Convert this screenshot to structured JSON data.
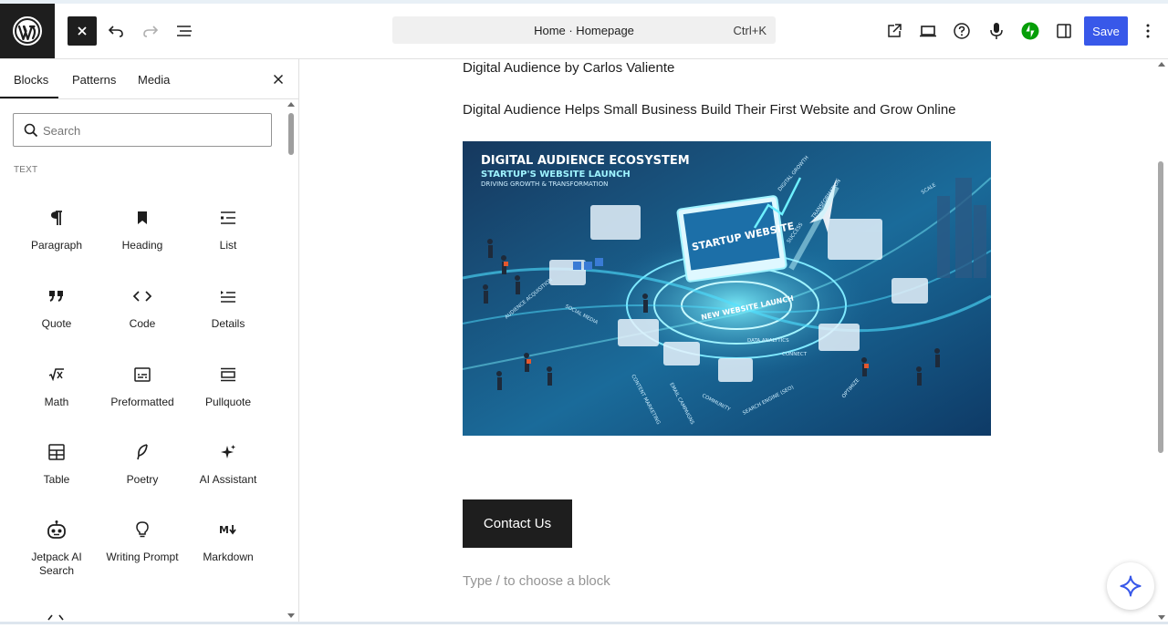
{
  "topbar": {
    "logo_icon": "wordpress-logo",
    "close_inserter_icon": "close-icon",
    "undo_icon": "undo-icon",
    "redo_icon": "redo-icon",
    "document_overview_icon": "list-view-icon",
    "command_bar": {
      "title": "Home · Homepage",
      "shortcut": "Ctrl+K"
    },
    "right_icons": [
      "external-link-icon",
      "desktop-preview-icon",
      "help-icon",
      "microphone-icon",
      "jetpack-icon",
      "sidebar-toggle-icon"
    ],
    "save_label": "Save",
    "options_icon": "more-vertical-icon"
  },
  "sidebar": {
    "tabs": [
      "Blocks",
      "Patterns",
      "Media"
    ],
    "active_tab": "Blocks",
    "search": {
      "placeholder": "Search",
      "value": ""
    },
    "category": "TEXT",
    "blocks": [
      {
        "label": "Paragraph",
        "icon": "paragraph-icon"
      },
      {
        "label": "Heading",
        "icon": "heading-bookmark-icon"
      },
      {
        "label": "List",
        "icon": "list-icon"
      },
      {
        "label": "Quote",
        "icon": "quote-icon"
      },
      {
        "label": "Code",
        "icon": "code-icon"
      },
      {
        "label": "Details",
        "icon": "details-icon"
      },
      {
        "label": "Math",
        "icon": "math-icon"
      },
      {
        "label": "Preformatted",
        "icon": "preformatted-icon"
      },
      {
        "label": "Pullquote",
        "icon": "pullquote-icon"
      },
      {
        "label": "Table",
        "icon": "table-icon"
      },
      {
        "label": "Poetry",
        "icon": "poetry-icon"
      },
      {
        "label": "AI Assistant",
        "icon": "ai-sparkle-icon"
      },
      {
        "label": "Jetpack AI Search",
        "icon": "robot-icon"
      },
      {
        "label": "Writing Prompt",
        "icon": "lightbulb-icon"
      },
      {
        "label": "Markdown",
        "icon": "markdown-icon"
      }
    ]
  },
  "canvas": {
    "line1": "Digital Audience by Carlos Valiente",
    "line2": "Digital Audience Helps Small Business Build Their First Website and Grow Online",
    "image": {
      "title": "DIGITAL AUDIENCE ECOSYSTEM",
      "subtitle": "STARTUP'S WEBSITE LAUNCH",
      "tagline": "DRIVING GROWTH & TRANSFORMATION",
      "screen_text": "STARTUP WEBSITE",
      "ring_text": "NEW WEBSITE LAUNCH",
      "labels": [
        "SOCIAL MEDIA",
        "AUDIENCE ACQUISITION",
        "CONTENT MARKETING",
        "EMAIL CAMPAIGNS",
        "COMMUNITY",
        "SEARCH ENGINE (SEO)",
        "DATA ANALYTICS",
        "DIGITAL GROWTH",
        "TRANSFORMATION",
        "SUCCESS",
        "SCALE",
        "OPTIMIZE",
        "CONNECT"
      ]
    },
    "contact_button": "Contact Us",
    "placeholder": "Type / to choose a block"
  },
  "colors": {
    "accent": "#3858e9",
    "dark": "#1e1e1e",
    "jetpack": "#069e08",
    "border": "#e0e0e0"
  }
}
